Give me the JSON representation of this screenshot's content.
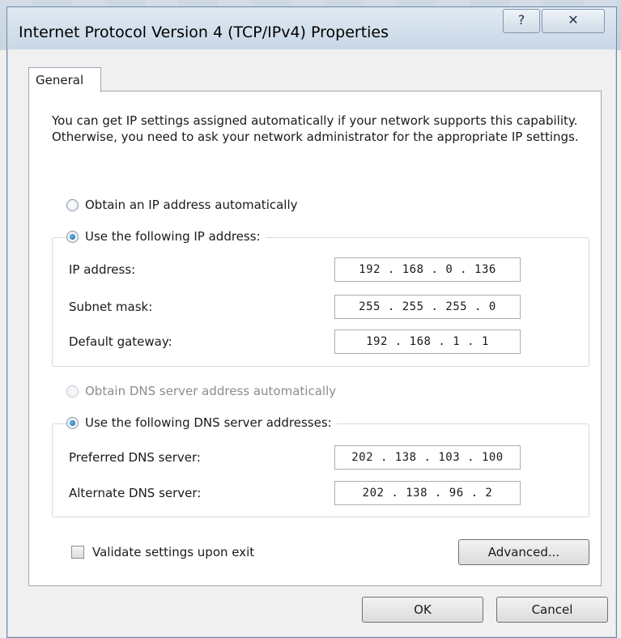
{
  "window": {
    "title": "Internet Protocol Version 4 (TCP/IPv4) Properties",
    "help_glyph": "?",
    "close_glyph": "✕"
  },
  "tabs": [
    {
      "label": "General"
    }
  ],
  "general": {
    "description": "You can get IP settings assigned automatically if your network supports this capability. Otherwise, you need to ask your network administrator for the appropriate IP settings.",
    "ip_auto_label": "Obtain an IP address automatically",
    "ip_manual_label": "Use the following IP address:",
    "ip_fields": [
      {
        "label": "IP address:",
        "value": "192 . 168 .  0  . 136"
      },
      {
        "label": "Subnet mask:",
        "value": "255 . 255 . 255 .  0"
      },
      {
        "label": "Default gateway:",
        "value": "192 . 168 .  1  .  1"
      }
    ],
    "dns_auto_label": "Obtain DNS server address automatically",
    "dns_manual_label": "Use the following DNS server addresses:",
    "dns_fields": [
      {
        "label": "Preferred DNS server:",
        "value": "202 . 138 . 103 . 100"
      },
      {
        "label": "Alternate DNS server:",
        "value": "202 . 138 .  96  .  2"
      }
    ],
    "validate_label": "Validate settings upon exit",
    "advanced_label": "Advanced..."
  },
  "footer": {
    "ok_label": "OK",
    "cancel_label": "Cancel"
  },
  "colors": {
    "radio_selected": "#0f5c9a",
    "titlebar": "#c9d7e6"
  }
}
